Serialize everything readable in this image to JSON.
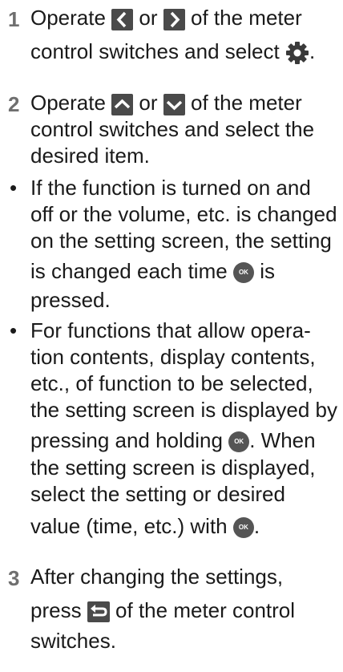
{
  "steps": [
    {
      "number": "1",
      "lines": [
        {
          "before": "Operate",
          "middle": "or",
          "after": "of the meter"
        },
        {
          "text": "control switches and select",
          "end": "."
        }
      ]
    },
    {
      "number": "2",
      "lines": [
        {
          "before": "Operate",
          "middle": "or",
          "after": "of the meter"
        },
        {
          "text": "control switches and select the"
        },
        {
          "text": "desired item."
        }
      ]
    },
    {
      "number": "3",
      "lines": [
        {
          "text": "After changing the settings,"
        },
        {
          "before": "press",
          "after": "of the meter control"
        },
        {
          "text": "switches."
        }
      ]
    }
  ],
  "bullets": [
    {
      "symbol": "•",
      "lines": [
        {
          "text": "If the function is turned on and"
        },
        {
          "text": "off or the volume, etc. is changed"
        },
        {
          "text": "on the setting screen, the setting"
        },
        {
          "before": "is changed each time",
          "after": "is"
        },
        {
          "text": "pressed."
        }
      ]
    },
    {
      "symbol": "•",
      "lines": [
        {
          "text": "For functions that allow opera-"
        },
        {
          "text": "tion contents, display contents,"
        },
        {
          "text": "etc., of function to be selected,"
        },
        {
          "text": "the setting screen is displayed by"
        },
        {
          "before": "pressing and holding",
          "after": ". When"
        },
        {
          "text": "the setting screen is displayed,"
        },
        {
          "text": "select the setting or desired"
        },
        {
          "before": "value (time, etc.) with",
          "after": "."
        }
      ]
    }
  ],
  "icons": {
    "ok_label": "OK",
    "left": "chevron-left-icon",
    "right": "chevron-right-icon",
    "up": "chevron-up-icon",
    "down": "chevron-down-icon",
    "settings": "gear-icon",
    "back": "back-arrow-icon",
    "ok": "ok-button-icon"
  },
  "colors": {
    "text": "#1a1a1a",
    "step_number": "#6f6f6f",
    "icon_fill": "#4a4a4a"
  }
}
